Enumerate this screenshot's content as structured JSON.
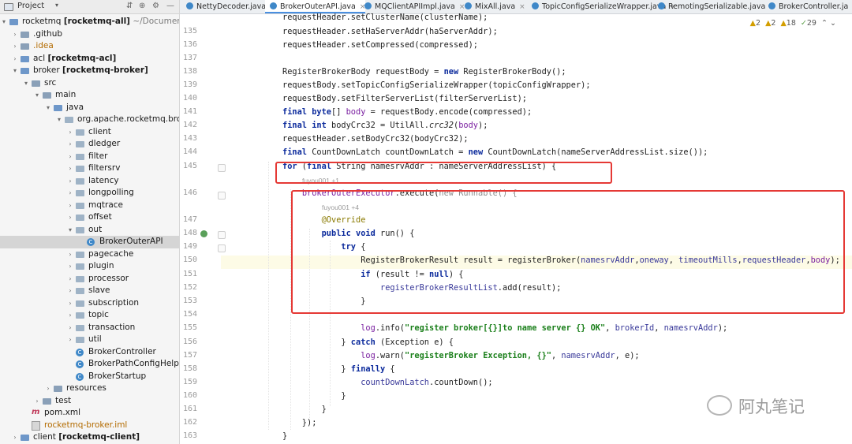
{
  "project_panel": {
    "title": "Project",
    "tree": [
      {
        "label": "rocketmq",
        "module": "[rocketmq-all]",
        "path": "~/Documents/o",
        "level": 0,
        "arrow": "▾",
        "icon": "folder-blue"
      },
      {
        "label": ".github",
        "level": 1,
        "arrow": "›",
        "icon": "folder"
      },
      {
        "label": ".idea",
        "level": 1,
        "arrow": "›",
        "icon": "folder",
        "style": "orange"
      },
      {
        "label": "acl",
        "module": "[rocketmq-acl]",
        "level": 1,
        "arrow": "›",
        "icon": "folder-blue"
      },
      {
        "label": "broker",
        "module": "[rocketmq-broker]",
        "level": 1,
        "arrow": "▾",
        "icon": "folder-blue"
      },
      {
        "label": "src",
        "level": 2,
        "arrow": "▾",
        "icon": "folder"
      },
      {
        "label": "main",
        "level": 3,
        "arrow": "▾",
        "icon": "folder"
      },
      {
        "label": "java",
        "level": 4,
        "arrow": "▾",
        "icon": "folder-src"
      },
      {
        "label": "org.apache.rocketmq.brok",
        "level": 5,
        "arrow": "▾",
        "icon": "package"
      },
      {
        "label": "client",
        "level": 6,
        "arrow": "›",
        "icon": "package"
      },
      {
        "label": "dledger",
        "level": 6,
        "arrow": "›",
        "icon": "package"
      },
      {
        "label": "filter",
        "level": 6,
        "arrow": "›",
        "icon": "package"
      },
      {
        "label": "filtersrv",
        "level": 6,
        "arrow": "›",
        "icon": "package"
      },
      {
        "label": "latency",
        "level": 6,
        "arrow": "›",
        "icon": "package"
      },
      {
        "label": "longpolling",
        "level": 6,
        "arrow": "›",
        "icon": "package"
      },
      {
        "label": "mqtrace",
        "level": 6,
        "arrow": "›",
        "icon": "package"
      },
      {
        "label": "offset",
        "level": 6,
        "arrow": "›",
        "icon": "package"
      },
      {
        "label": "out",
        "level": 6,
        "arrow": "▾",
        "icon": "package"
      },
      {
        "label": "BrokerOuterAPI",
        "level": 7,
        "arrow": "",
        "icon": "class",
        "selected": true
      },
      {
        "label": "pagecache",
        "level": 6,
        "arrow": "›",
        "icon": "package"
      },
      {
        "label": "plugin",
        "level": 6,
        "arrow": "›",
        "icon": "package"
      },
      {
        "label": "processor",
        "level": 6,
        "arrow": "›",
        "icon": "package"
      },
      {
        "label": "slave",
        "level": 6,
        "arrow": "›",
        "icon": "package"
      },
      {
        "label": "subscription",
        "level": 6,
        "arrow": "›",
        "icon": "package"
      },
      {
        "label": "topic",
        "level": 6,
        "arrow": "›",
        "icon": "package"
      },
      {
        "label": "transaction",
        "level": 6,
        "arrow": "›",
        "icon": "package"
      },
      {
        "label": "util",
        "level": 6,
        "arrow": "›",
        "icon": "package"
      },
      {
        "label": "BrokerController",
        "level": 6,
        "arrow": "",
        "icon": "class"
      },
      {
        "label": "BrokerPathConfigHelpe",
        "level": 6,
        "arrow": "",
        "icon": "class"
      },
      {
        "label": "BrokerStartup",
        "level": 6,
        "arrow": "",
        "icon": "class"
      },
      {
        "label": "resources",
        "level": 4,
        "arrow": "›",
        "icon": "folder"
      },
      {
        "label": "test",
        "level": 3,
        "arrow": "›",
        "icon": "folder"
      },
      {
        "label": "pom.xml",
        "level": 2,
        "arrow": "",
        "icon": "maven"
      },
      {
        "label": "rocketmq-broker.iml",
        "level": 2,
        "arrow": "",
        "icon": "iml",
        "style": "orange"
      },
      {
        "label": "client",
        "module": "[rocketmq-client]",
        "level": 1,
        "arrow": "›",
        "icon": "folder-blue"
      }
    ]
  },
  "tabs": [
    {
      "label": "NettyDecoder.java",
      "active": false
    },
    {
      "label": "BrokerOuterAPI.java",
      "active": true
    },
    {
      "label": "MQClientAPIImpl.java",
      "active": false
    },
    {
      "label": "MixAll.java",
      "active": false
    },
    {
      "label": "TopicConfigSerializeWrapper.java",
      "active": false
    },
    {
      "label": "RemotingSerializable.java",
      "active": false
    },
    {
      "label": "BrokerController.ja",
      "active": false
    }
  ],
  "inspections": {
    "warnings_a": "2",
    "warnings_b": "2",
    "weak_warnings": "18",
    "ok": "29"
  },
  "hints": {
    "author_145": "fuyou001 +1",
    "author_146": "fuyou001 +4"
  },
  "code_lines": [
    {
      "n": "",
      "html": "requestHeader.setClusterName(clusterName);"
    },
    {
      "n": "135",
      "html": "requestHeader.setHaServerAddr(haServerAddr);"
    },
    {
      "n": "136",
      "html": "requestHeader.setCompressed(compressed);"
    },
    {
      "n": "137",
      "html": ""
    },
    {
      "n": "138",
      "html": "RegisterBrokerBody requestBody = <span class=\"kw\">new</span> RegisterBrokerBody();"
    },
    {
      "n": "139",
      "html": "requestBody.setTopicConfigSerializeWrapper(topicConfigWrapper);"
    },
    {
      "n": "140",
      "html": "requestBody.setFilterServerList(filterServerList);"
    },
    {
      "n": "141",
      "html": "<span class=\"kw\">final byte</span>[] <span class=\"field\">body</span> = requestBody.encode(compressed);"
    },
    {
      "n": "142",
      "html": "<span class=\"kw\">final int</span> bodyCrc32 = UtilAll.<span class=\"italic\">crc32</span>(<span class=\"field\">body</span>);"
    },
    {
      "n": "143",
      "html": "requestHeader.setBodyCrc32(bodyCrc32);"
    },
    {
      "n": "144",
      "html": "<span class=\"kw\">final</span> CountDownLatch countDownLatch = <span class=\"kw\">new</span> CountDownLatch(nameServerAddressList.size());"
    },
    {
      "n": "145",
      "html": "<span class=\"kw\">for</span> (<span class=\"kw\">final</span> String namesrvAddr : nameServerAddressList) {"
    },
    {
      "n": "146",
      "html": "    <span class=\"field\">brokerOuterExecutor</span>.execute(<span class=\"gray\">new Runnable() {</span>"
    },
    {
      "n": "147",
      "html": "        <span class=\"ann\">@Override</span>"
    },
    {
      "n": "148",
      "html": "        <span class=\"kw\">public void</span> run() {"
    },
    {
      "n": "149",
      "html": "            <span class=\"kw\">try</span> {"
    },
    {
      "n": "150",
      "html": "                RegisterBrokerResult result = registerBroker(<span class=\"param\">namesrvAddr</span>,<span class=\"param\">oneway</span>, <span class=\"param\">timeoutMills</span>,<span class=\"param\">requestHeader</span>,<span class=\"field\">body</span>);"
    },
    {
      "n": "151",
      "html": "                <span class=\"kw\">if</span> (result != <span class=\"kw\">null</span>) {"
    },
    {
      "n": "152",
      "html": "                    <span class=\"param\">registerBrokerResultList</span>.add(result);"
    },
    {
      "n": "153",
      "html": "                }"
    },
    {
      "n": "154",
      "html": ""
    },
    {
      "n": "155",
      "html": "                <span class=\"field\">log</span>.info(<span class=\"str\">\"register broker[{}]to name server {} OK\"</span>, <span class=\"param\">brokerId</span>, <span class=\"param\">namesrvAddr</span>);"
    },
    {
      "n": "156",
      "html": "            } <span class=\"kw\">catch</span> (Exception e) {"
    },
    {
      "n": "157",
      "html": "                <span class=\"field\">log</span>.warn(<span class=\"str\">\"registerBroker Exception, {}\"</span>, <span class=\"param\">namesrvAddr</span>, e);"
    },
    {
      "n": "158",
      "html": "            } <span class=\"kw\">finally</span> {"
    },
    {
      "n": "159",
      "html": "                <span class=\"param\">countDownLatch</span>.countDown();"
    },
    {
      "n": "160",
      "html": "            }"
    },
    {
      "n": "161",
      "html": "        }"
    },
    {
      "n": "162",
      "html": "    });"
    },
    {
      "n": "163",
      "html": "}"
    }
  ],
  "watermark": "阿丸笔记"
}
